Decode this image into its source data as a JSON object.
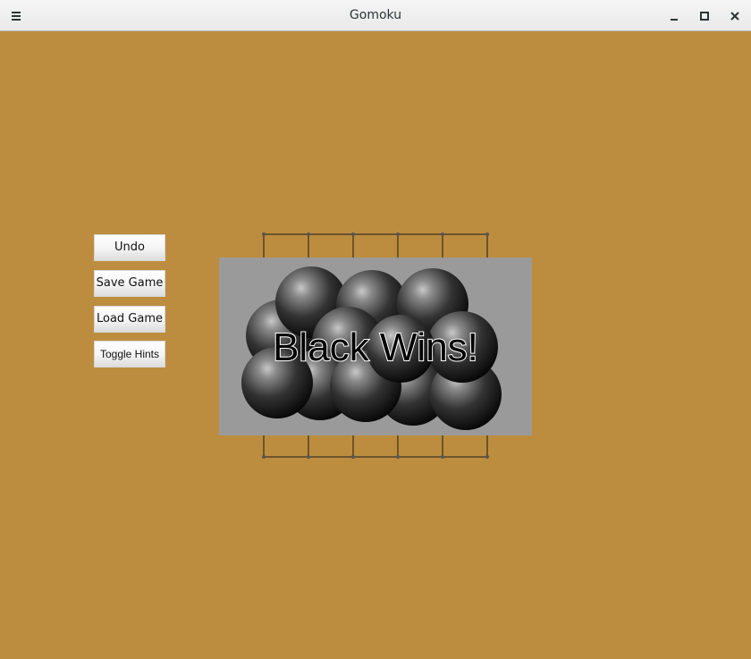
{
  "window": {
    "title": "Gomoku",
    "background_color": "#bd8d3f"
  },
  "titlebar_icons": {
    "menu": "hamburger-menu-icon",
    "minimize": "minimize-icon",
    "maximize": "maximize-icon",
    "close": "close-icon"
  },
  "controls": {
    "undo_label": "Undo",
    "save_label": "Save Game",
    "load_label": "Load Game",
    "hints_label": "Toggle Hints"
  },
  "game": {
    "result_message": "Black Wins!",
    "overlay_color": "#9a9a9a",
    "stone_color": "black",
    "black_stone_count": 12
  }
}
